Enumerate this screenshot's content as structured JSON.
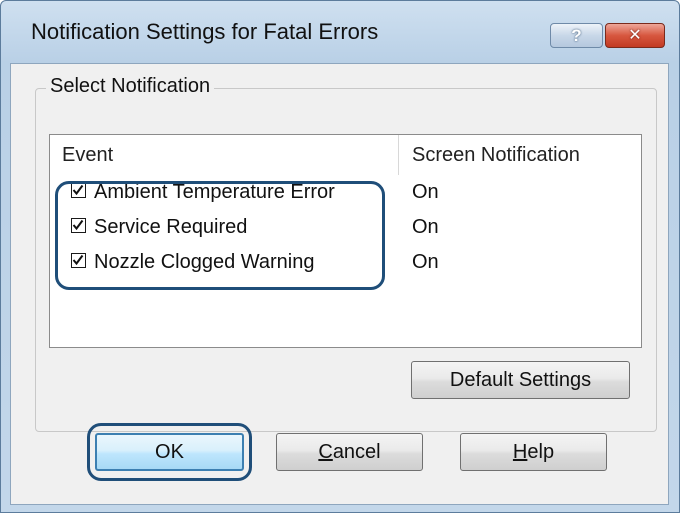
{
  "window": {
    "title": "Notification Settings for Fatal Errors",
    "help_glyph": "?",
    "close_glyph": "✕"
  },
  "group": {
    "title": "Select Notification"
  },
  "table": {
    "columns": [
      "Event",
      "Screen Notification"
    ],
    "rows": [
      {
        "event": "Ambient Temperature Error",
        "checked": true,
        "screen_notification": "On"
      },
      {
        "event": "Service Required",
        "checked": true,
        "screen_notification": "On"
      },
      {
        "event": "Nozzle Clogged Warning",
        "checked": true,
        "screen_notification": "On"
      }
    ]
  },
  "buttons": {
    "default_settings": "Default Settings",
    "ok": "OK",
    "cancel_mnemonic": "C",
    "cancel_rest": "ancel",
    "help_mnemonic": "H",
    "help_rest": "elp"
  },
  "colors": {
    "highlight": "#1f4e79",
    "close_button": "#c23a22",
    "title_bar": "#b9d0e6"
  }
}
